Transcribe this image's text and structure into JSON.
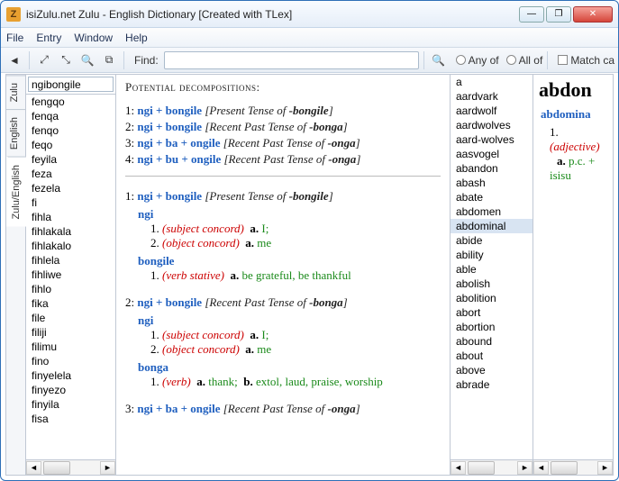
{
  "window": {
    "title": "isiZulu.net Zulu - English Dictionary [Created with TLex]",
    "app_icon_char": "Z"
  },
  "menu": {
    "file": "File",
    "entry": "Entry",
    "window": "Window",
    "help": "Help"
  },
  "toolbar": {
    "find_label": "Find:",
    "find_value": "",
    "any_of": "Any of",
    "all_of": "All of",
    "match_case": "Match ca"
  },
  "vtabs": {
    "zulu": "Zulu",
    "english": "English",
    "zulu_english": "Zulu/English"
  },
  "left": {
    "search_value": "ngibongile",
    "words": [
      "fengqo",
      "fenqa",
      "fenqo",
      "feqo",
      "feyila",
      "feza",
      "fezela",
      "fi",
      "fihla",
      "fihlakala",
      "fihlakalo",
      "fihlela",
      "fihliwe",
      "fihlo",
      "fika",
      "file",
      "filiji",
      "filimu",
      "fino",
      "finyelela",
      "finyezo",
      "finyila",
      "fisa"
    ]
  },
  "center": {
    "heading": "Potential decompositions:",
    "summary": [
      {
        "n": "1",
        "parts": "ngi + bongile",
        "tense": "Present Tense of",
        "root": "-bongile"
      },
      {
        "n": "2",
        "parts": "ngi + bongile",
        "tense": "Recent Past Tense of",
        "root": "-bonga"
      },
      {
        "n": "3",
        "parts": "ngi + ba + ongile",
        "tense": "Recent Past Tense of",
        "root": "-onga"
      },
      {
        "n": "4",
        "parts": "ngi + bu + ongile",
        "tense": "Recent Past Tense of",
        "root": "-onga"
      }
    ],
    "detail1": {
      "n": "1",
      "parts": "ngi + bongile",
      "tense": "Present Tense of",
      "root": "-bongile",
      "ngi_label": "ngi",
      "ngi_senses": [
        {
          "sn": "1.",
          "pos": "(subject concord)",
          "sl": "a.",
          "gloss": "I;"
        },
        {
          "sn": "2.",
          "pos": "(object concord)",
          "sl": "a.",
          "gloss": "me"
        }
      ],
      "bongile_label": "bongile",
      "bongile_senses": [
        {
          "sn": "1.",
          "pos": "(verb stative)",
          "sl": "a.",
          "gloss": "be grateful, be thankful"
        }
      ]
    },
    "detail2": {
      "n": "2",
      "parts": "ngi + bongile",
      "tense": "Recent Past Tense of",
      "root": "-bonga",
      "ngi_label": "ngi",
      "ngi_senses": [
        {
          "sn": "1.",
          "pos": "(subject concord)",
          "sl": "a.",
          "gloss": "I;"
        },
        {
          "sn": "2.",
          "pos": "(object concord)",
          "sl": "a.",
          "gloss": "me"
        }
      ],
      "bonga_label": "bonga",
      "bonga_senses": [
        {
          "sn": "1.",
          "pos": "(verb)",
          "sl_a": "a.",
          "gloss_a": "thank;",
          "sl_b": "b.",
          "gloss_b": "extol, laud, praise, worship"
        }
      ]
    },
    "detail3": {
      "n": "3",
      "parts": "ngi + ba + ongile",
      "tense": "Recent Past Tense of",
      "root": "-onga"
    }
  },
  "right_a": {
    "words": [
      "a",
      "aardvark",
      "aardwolf",
      "aardwolves",
      "aard-wolves",
      "aasvogel",
      "abandon",
      "abash",
      "abate",
      "abdomen",
      "abdominal",
      "abide",
      "ability",
      "able",
      "abolish",
      "abolition",
      "abort",
      "abortion",
      "abound",
      "about",
      "above",
      "abrade"
    ],
    "selected": "abdominal"
  },
  "right_b": {
    "headword_big": "abdon",
    "headword": "abdomina",
    "sn": "1.",
    "pos": "(adjective)",
    "sl": "a.",
    "gloss1": "p.c. +",
    "gloss2": "isisu"
  }
}
